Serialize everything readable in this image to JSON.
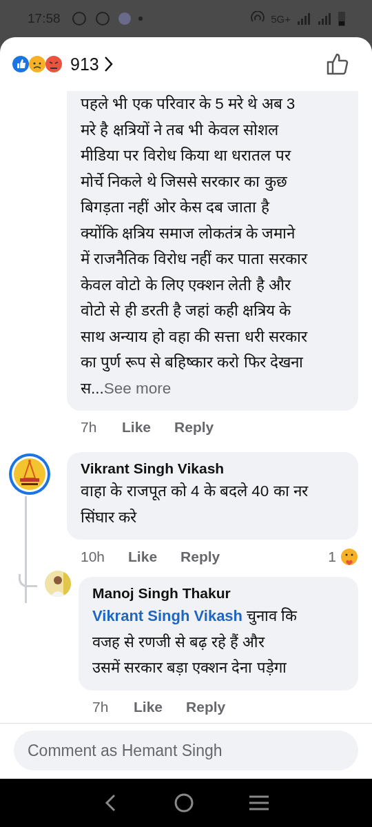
{
  "status_bar": {
    "time": "17:58",
    "network": "5G+"
  },
  "header": {
    "reaction_count": "913"
  },
  "comments": [
    {
      "kind": "comment",
      "lines": [
        "पहले भी एक परिवार के 5 मरे थे अब 3",
        "मरे है क्षत्रियों ने तब भी केवल सोशल",
        "मीडिया पर विरोध किया था धरातल पर",
        "मोर्चे निकले थे जिससे सरकार का कुछ",
        "बिगड़ता नहीं ओर केस दब जाता है",
        "क्योंकि क्षत्रिय समाज लोकतंत्र के जमाने",
        "में राजनैतिक विरोध नहीं कर पाता सरकार",
        "केवल वोटो के लिए एक्शन लेती है और",
        "वोटो से ही डरती है जहां कही क्षत्रिय के",
        "साथ अन्याय हो वहा की सत्ता धरी सरकार",
        "का पुर्ण रूप से बहिष्कार करो फिर देखना",
        "स..."
      ],
      "see_more": "See more",
      "time": "7h",
      "like": "Like",
      "reply": "Reply"
    },
    {
      "kind": "comment",
      "author": "Vikrant Singh Vikash",
      "lines": [
        "वाहा के राजपूत को 4 के बदले 40 का नर",
        "सिंघार करे"
      ],
      "time": "10h",
      "like": "Like",
      "reply": "Reply",
      "reaction_count": "1",
      "replies": [
        {
          "author": "Manoj Singh Thakur",
          "mention": "Vikrant Singh Vikash",
          "lines": [
            "चुनाव कि",
            "वजह से रणजी से बढ़ रहे हैं और",
            "उसमें सरकार बड़ा एक्शन देना पड़ेगा"
          ],
          "time": "7h",
          "like": "Like",
          "reply": "Reply"
        }
      ]
    }
  ],
  "composer": {
    "placeholder": "Comment as Hemant Singh"
  }
}
